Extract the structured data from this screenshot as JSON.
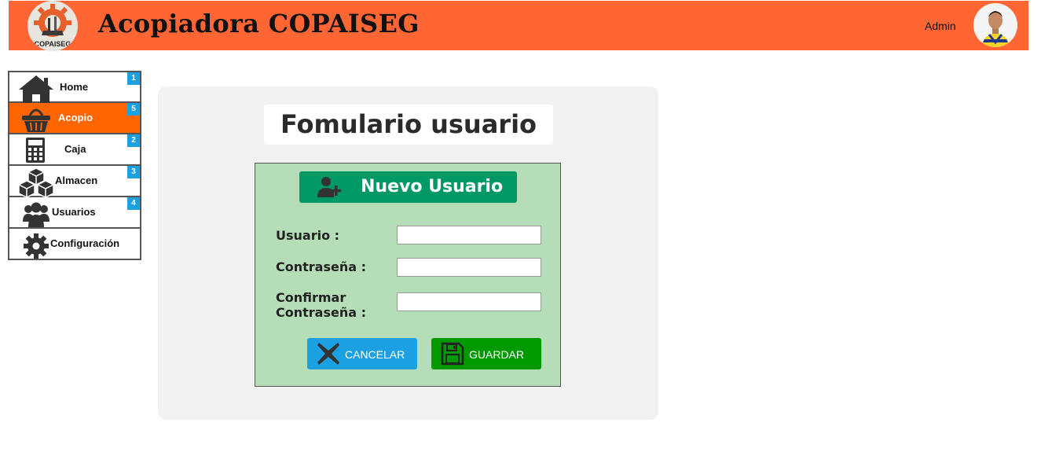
{
  "header": {
    "app_title": "Acopiadora COPAISEG",
    "logo_text": "COPAISEG",
    "user_name": "Admin"
  },
  "sidebar": {
    "items": [
      {
        "label": "Home",
        "badge": "1",
        "icon": "home-icon",
        "active": false
      },
      {
        "label": "Acopio",
        "badge": "5",
        "icon": "basket-icon",
        "active": true
      },
      {
        "label": "Caja",
        "badge": "2",
        "icon": "calculator-icon",
        "active": false
      },
      {
        "label": "Almacen",
        "badge": "3",
        "icon": "boxes-icon",
        "active": false
      },
      {
        "label": "Usuarios",
        "badge": "4",
        "icon": "users-icon",
        "active": false
      },
      {
        "label": "Configuración",
        "badge": "",
        "icon": "gear-icon",
        "active": false
      }
    ]
  },
  "form": {
    "title": "Fomulario usuario",
    "banner_label": "Nuevo Usuario",
    "fields": {
      "usuario": {
        "label": "Usuario :",
        "value": ""
      },
      "contrasena": {
        "label": "Contraseña :",
        "value": ""
      },
      "confirmar_line1": "Confirmar",
      "confirmar_line2": "Contraseña :",
      "confirmar_value": ""
    },
    "cancel_label": "CANCELAR",
    "save_label": "GUARDAR"
  },
  "colors": {
    "header_bg": "#ff6633",
    "active_nav": "#ff6600",
    "badge": "#1ba1e2",
    "form_bg": "#b5ddb7",
    "banner": "#009966",
    "cancel": "#1ba1e2",
    "save": "#009a00"
  }
}
